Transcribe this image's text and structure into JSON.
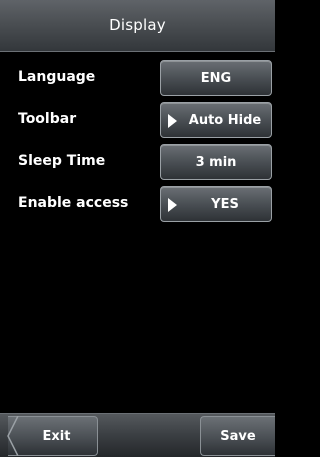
{
  "header": {
    "title": "Display"
  },
  "settings": [
    {
      "label": "Language",
      "value": "ENG",
      "arrow": false
    },
    {
      "label": "Toolbar",
      "value": "Auto Hide",
      "arrow": true
    },
    {
      "label": "Sleep Time",
      "value": "3 min",
      "arrow": false
    },
    {
      "label": "Enable access",
      "value": "YES",
      "arrow": true
    }
  ],
  "footer": {
    "exit_label": "Exit",
    "save_label": "Save"
  },
  "icons": {
    "arrow": "play-arrow-icon",
    "back": "back-notch-icon"
  }
}
